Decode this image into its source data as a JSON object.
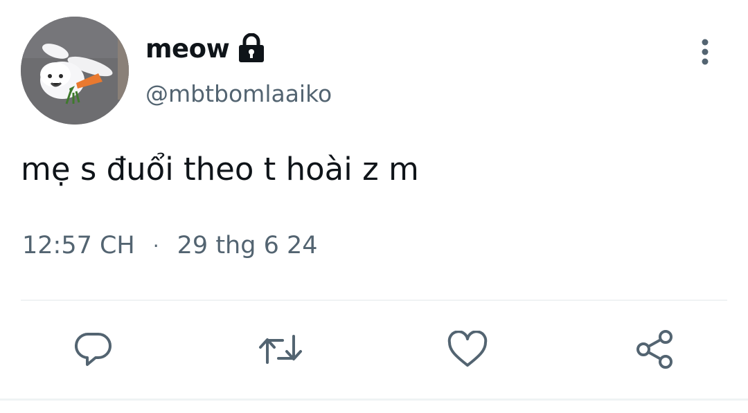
{
  "tweet": {
    "display_name": "meow",
    "handle": "@mbtbomlaaiko",
    "text": "mẹ s đuổi theo t hoài z m",
    "time": "12:57 CH",
    "separator": "·",
    "date": "29 thg 6 24",
    "protected_icon": "lock-icon",
    "more_icon": "more-vertical-icon",
    "avatar_subject": "avatar"
  },
  "actions": [
    {
      "icon": "reply-icon"
    },
    {
      "icon": "retweet-icon"
    },
    {
      "icon": "like-icon"
    },
    {
      "icon": "share-icon"
    }
  ],
  "colors": {
    "text_primary": "#0f1419",
    "text_secondary": "#536471",
    "divider": "#eff3f4",
    "icon": "#536471"
  }
}
